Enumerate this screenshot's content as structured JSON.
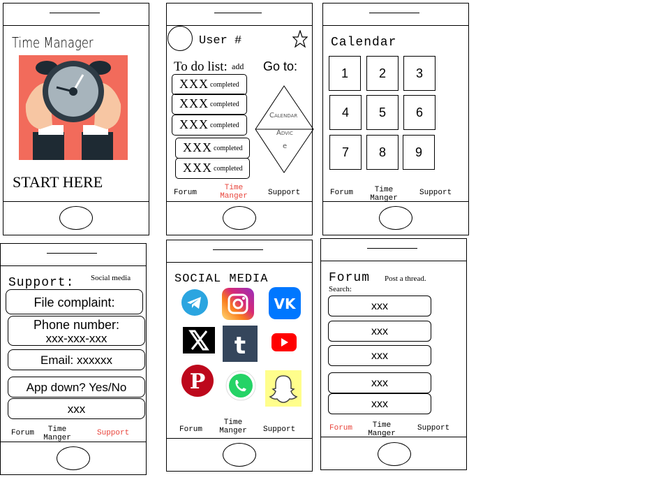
{
  "start": {
    "title": "Time Manager",
    "cta": "START HERE"
  },
  "todo": {
    "user": "User #",
    "heading": "To do list:",
    "add": "add",
    "goto": "Go to:",
    "items": [
      {
        "text": "XXX",
        "status": "completed"
      },
      {
        "text": "XXX",
        "status": "completed"
      },
      {
        "text": "XXX",
        "status": "completed"
      },
      {
        "text": "XXX",
        "status": "completed"
      },
      {
        "text": "XXX",
        "status": "completed"
      }
    ],
    "diamond_calendar": "Calendar",
    "diamond_advice_1": "Advic",
    "diamond_advice_2": "e"
  },
  "calendar": {
    "title": "Calendar",
    "days": [
      "1",
      "2",
      "3",
      "4",
      "5",
      "6",
      "7",
      "8",
      "9"
    ]
  },
  "support": {
    "title": "Support:",
    "social": "Social media",
    "complaint": "File complaint:",
    "phone_label": "Phone number:",
    "phone_value": "xxx-xxx-xxx",
    "email": "Email: xxxxxx",
    "app_down": "App down? Yes/No",
    "extra": "xxx"
  },
  "social": {
    "title": "SOCIAL MEDIA",
    "icons": [
      "telegram-icon",
      "instagram-icon",
      "vk-icon",
      "x-icon",
      "tumblr-icon",
      "youtube-icon",
      "pinterest-icon",
      "whatsapp-icon",
      "snapchat-icon"
    ]
  },
  "forum": {
    "title": "Forum",
    "post": "Post a thread.",
    "search": "Search:",
    "threads": [
      "xxx",
      "xxx",
      "xxx",
      "xxx",
      "xxx"
    ]
  },
  "nav": {
    "forum": "Forum",
    "time_1": "Time",
    "time_2": "Manger",
    "support": "Support"
  },
  "colors": {
    "active_nav": "#e8433a",
    "clock_bg": "#f26b5b"
  }
}
